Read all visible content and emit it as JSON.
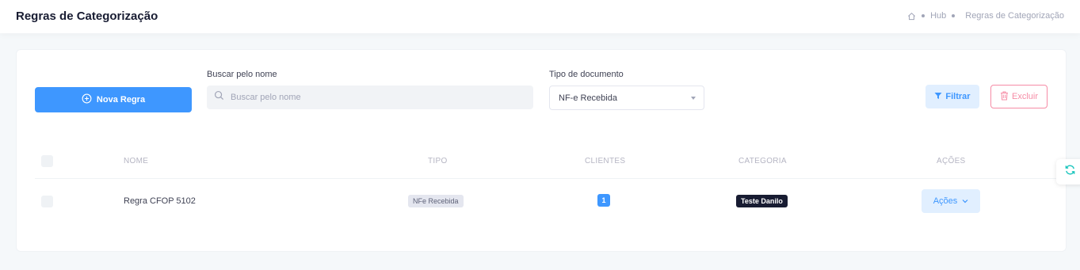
{
  "header": {
    "title": "Regras de Categorização",
    "breadcrumb": [
      "Hub",
      "Regras de Categorização"
    ],
    "home_icon": "home-icon"
  },
  "toolbar": {
    "new_rule_label": "Nova Regra",
    "new_rule_icon": "plus-circle-icon",
    "search_label": "Buscar pelo nome",
    "search_placeholder": "Buscar pelo nome",
    "search_value": "",
    "doc_type_label": "Tipo de documento",
    "doc_type_value": "NF-e Recebida",
    "filter_label": "Filtrar",
    "filter_icon": "funnel-icon",
    "delete_label": "Excluir",
    "delete_icon": "trash-icon"
  },
  "table": {
    "columns": [
      "NOME",
      "TIPO",
      "CLIENTES",
      "CATEGORIA",
      "AÇÕES"
    ],
    "rows": [
      {
        "name": "Regra CFOP 5102",
        "tipo": "NFe Recebida",
        "clientes": "1",
        "categoria": "Teste Danilo",
        "acoes_label": "Ações"
      }
    ]
  },
  "side_widget": {
    "icon": "refresh-icon"
  },
  "colors": {
    "primary": "#3e97ff",
    "primary_light": "#e1efff",
    "danger": "#f1416c",
    "dark": "#181c32",
    "background": "#f5f8fa"
  }
}
